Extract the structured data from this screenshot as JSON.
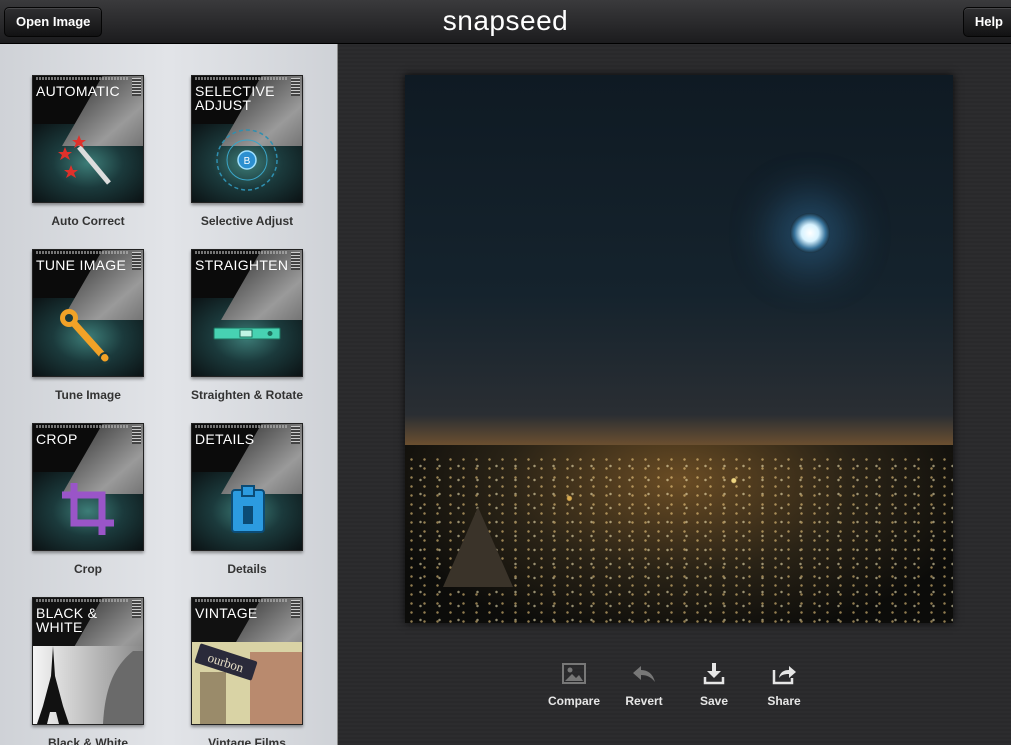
{
  "topbar": {
    "open_label": "Open Image",
    "app_title": "snapseed",
    "help_label": "Help"
  },
  "filters": [
    {
      "thumb": "AUTOMATIC",
      "label": "Auto Correct",
      "icon": "magic-wand-icon"
    },
    {
      "thumb": "SELECTIVE\nADJUST",
      "label": "Selective Adjust",
      "icon": "control-point-icon"
    },
    {
      "thumb": "TUNE IMAGE",
      "label": "Tune Image",
      "icon": "wrench-icon"
    },
    {
      "thumb": "STRAIGHTEN",
      "label": "Straighten & Rotate",
      "icon": "level-icon"
    },
    {
      "thumb": "CROP",
      "label": "Crop",
      "icon": "crop-icon"
    },
    {
      "thumb": "DETAILS",
      "label": "Details",
      "icon": "sharpener-icon"
    },
    {
      "thumb": "BLACK &\nWHITE",
      "label": "Black & White",
      "icon": "eiffel-tower-icon"
    },
    {
      "thumb": "VINTAGE",
      "label": "Vintage Films",
      "icon": "vintage-sign-icon"
    }
  ],
  "vintage_sign_text": "ourbon",
  "toolbar": {
    "compare": "Compare",
    "revert": "Revert",
    "save": "Save",
    "share": "Share"
  },
  "colors": {
    "accent_teal": "#4fb3c8",
    "toolbar_bg": "#1c1c1e"
  }
}
